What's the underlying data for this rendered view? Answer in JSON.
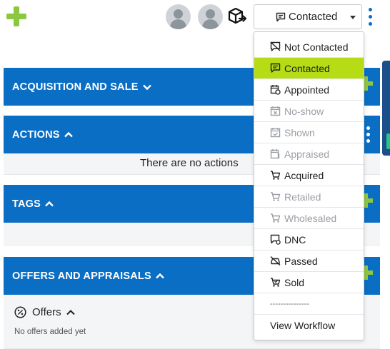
{
  "header": {
    "status_value": "Contacted",
    "add_icon": "plus-icon",
    "package_icon": "box-arrow-icon"
  },
  "colors": {
    "primary_blue": "#0a6ec4",
    "accent_green": "#8dc63f",
    "active_item": "#b5dc14"
  },
  "sections": {
    "acquisition": {
      "title": "ACQUISITION AND SALE"
    },
    "actions": {
      "title": "ACTIONS",
      "empty_text": "There are no actions"
    },
    "tags": {
      "title": "TAGS"
    },
    "offers": {
      "title": "OFFERS AND APPRAISALS",
      "sub_label": "Offers",
      "empty_text": "No offers added yet"
    }
  },
  "menu": {
    "items": [
      {
        "label": "Not Contacted",
        "state": "enabled",
        "icon": "chat-off-icon"
      },
      {
        "label": "Contacted",
        "state": "active",
        "icon": "chat-icon"
      },
      {
        "label": "Appointed",
        "state": "enabled",
        "icon": "calendar-clock-icon"
      },
      {
        "label": "No-show",
        "state": "disabled",
        "icon": "calendar-x-icon"
      },
      {
        "label": "Shown",
        "state": "disabled",
        "icon": "calendar-check-icon"
      },
      {
        "label": "Appraised",
        "state": "disabled",
        "icon": "calendar-dollar-icon"
      },
      {
        "label": "Acquired",
        "state": "enabled",
        "icon": "cart-icon"
      },
      {
        "label": "Retailed",
        "state": "disabled",
        "icon": "cart-tag-icon"
      },
      {
        "label": "Wholesaled",
        "state": "disabled",
        "icon": "cart-box-icon"
      },
      {
        "label": "DNC",
        "state": "enabled",
        "icon": "chat-block-icon"
      },
      {
        "label": "Passed",
        "state": "enabled",
        "icon": "car-off-icon"
      },
      {
        "label": "Sold",
        "state": "enabled",
        "icon": "cart-check-icon"
      }
    ],
    "separator": "---------------",
    "view_workflow": "View Workflow"
  }
}
